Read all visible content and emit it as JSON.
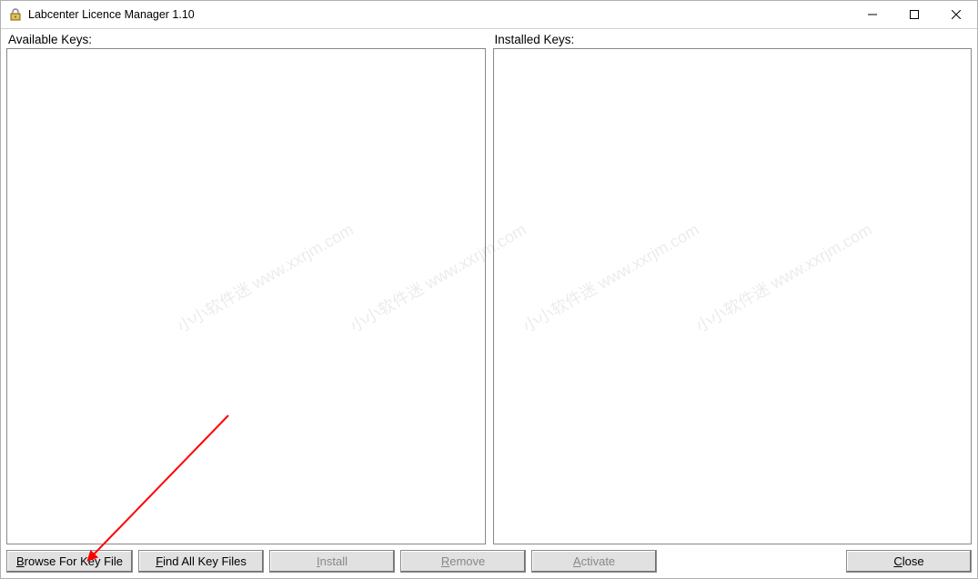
{
  "window": {
    "title": "Labcenter Licence Manager 1.10"
  },
  "panels": {
    "available_label": "Available Keys:",
    "installed_label": "Installed Keys:"
  },
  "buttons": {
    "browse": {
      "pre": "",
      "u": "B",
      "post": "rowse For Key File"
    },
    "find": {
      "pre": "",
      "u": "F",
      "post": "ind All Key Files"
    },
    "install": {
      "pre": "",
      "u": "I",
      "post": "nstall"
    },
    "remove": {
      "pre": "",
      "u": "R",
      "post": "emove"
    },
    "activate": {
      "pre": "",
      "u": "A",
      "post": "ctivate"
    },
    "close": {
      "pre": "",
      "u": "C",
      "post": "lose"
    }
  },
  "watermark_text": "小小软件迷 www.xxrjm.com"
}
